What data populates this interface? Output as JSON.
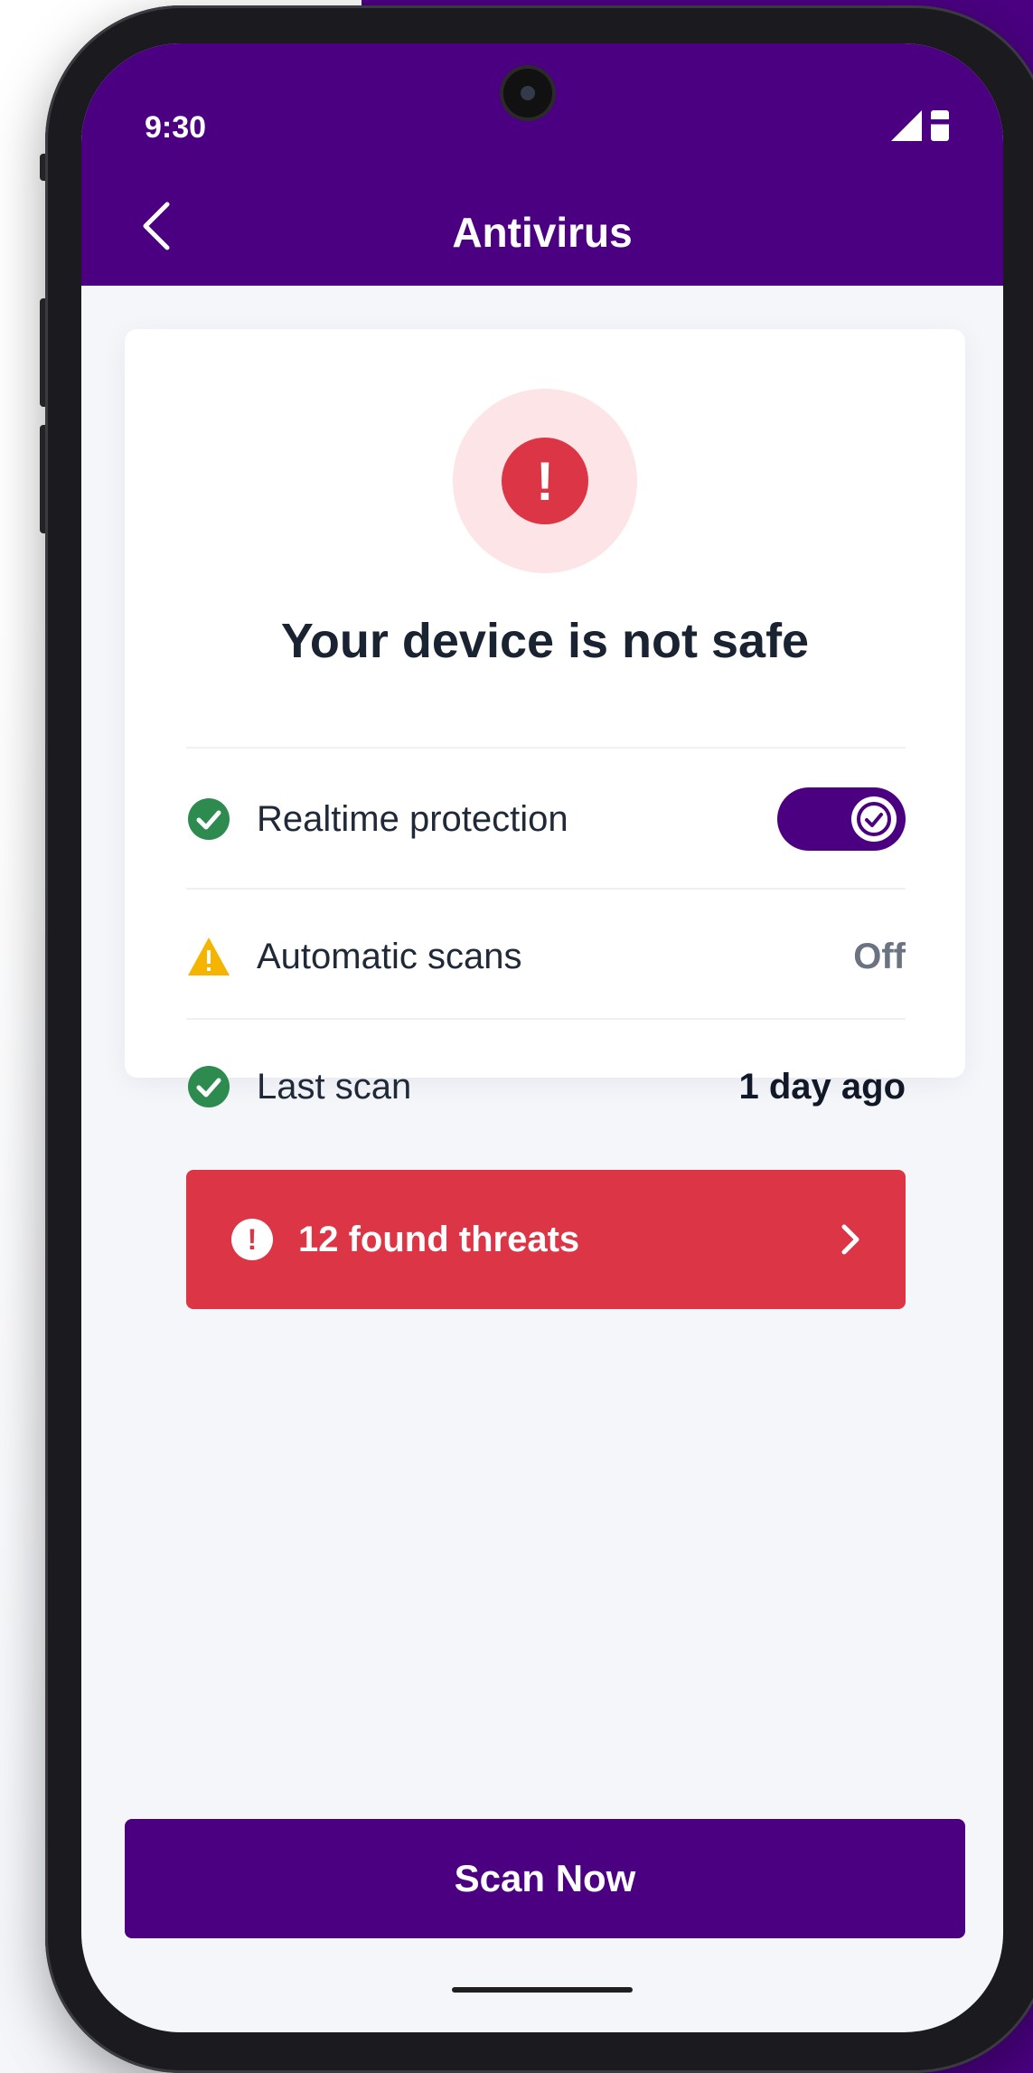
{
  "status_bar": {
    "time": "9:30"
  },
  "header": {
    "title": "Antivirus",
    "back_icon": "chevron-left-icon"
  },
  "card": {
    "status_icon": "exclamation-circle-icon",
    "status_glyph": "!",
    "title": "Your device is not safe",
    "rows": [
      {
        "label": "Realtime protection",
        "status": "ok",
        "control": "toggle",
        "toggle_on": true
      },
      {
        "label": "Automatic scans",
        "status": "warning",
        "value": "Off"
      },
      {
        "label": "Last scan",
        "status": "ok",
        "value": "1 day ago"
      }
    ],
    "threats": {
      "glyph": "!",
      "label": "12 found threats",
      "chevron_icon": "chevron-right-icon"
    }
  },
  "actions": {
    "scan_label": "Scan Now"
  },
  "colors": {
    "brand": "#4b0082",
    "danger": "#dc3545",
    "danger_soft": "#fde4e6",
    "success": "#2e8b4f",
    "warning": "#f5b400",
    "background": "#f4f6fa"
  }
}
